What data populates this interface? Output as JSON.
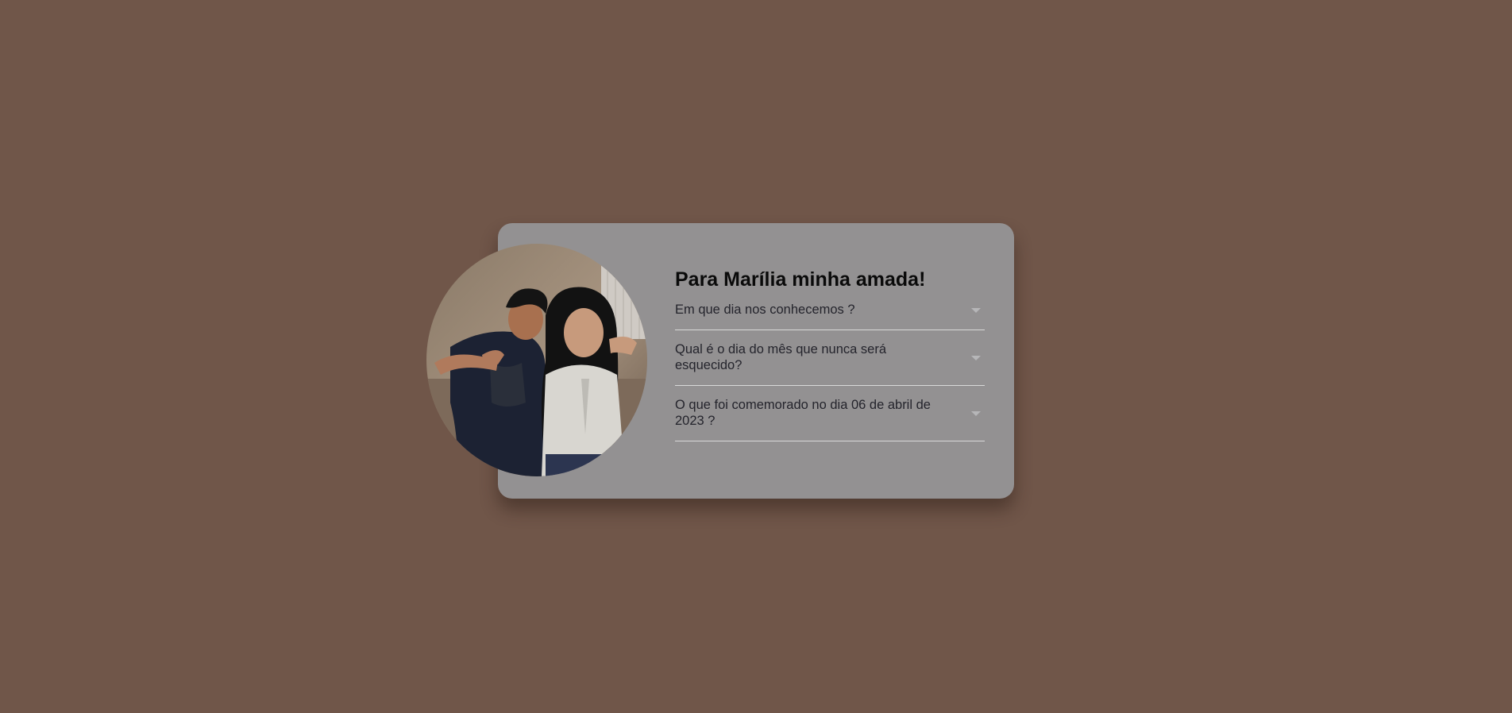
{
  "colors": {
    "background": "#705649",
    "card": "#939192",
    "title": "#0a0a0a",
    "question_text": "#24242c",
    "divider": "#d9d9d9",
    "chevron": "#b6b6b8"
  },
  "photo": {
    "icon": "couple-photo",
    "shape": "circle"
  },
  "title": "Para Marília minha amada!",
  "faq": [
    {
      "question": "Em que dia nos conhecemos ?",
      "icon": "chevron-down-icon"
    },
    {
      "question": "Qual é o dia do mês que nunca será esquecido?",
      "icon": "chevron-down-icon"
    },
    {
      "question": "O que foi comemorado no dia 06 de abril de 2023 ?",
      "icon": "chevron-down-icon"
    }
  ]
}
